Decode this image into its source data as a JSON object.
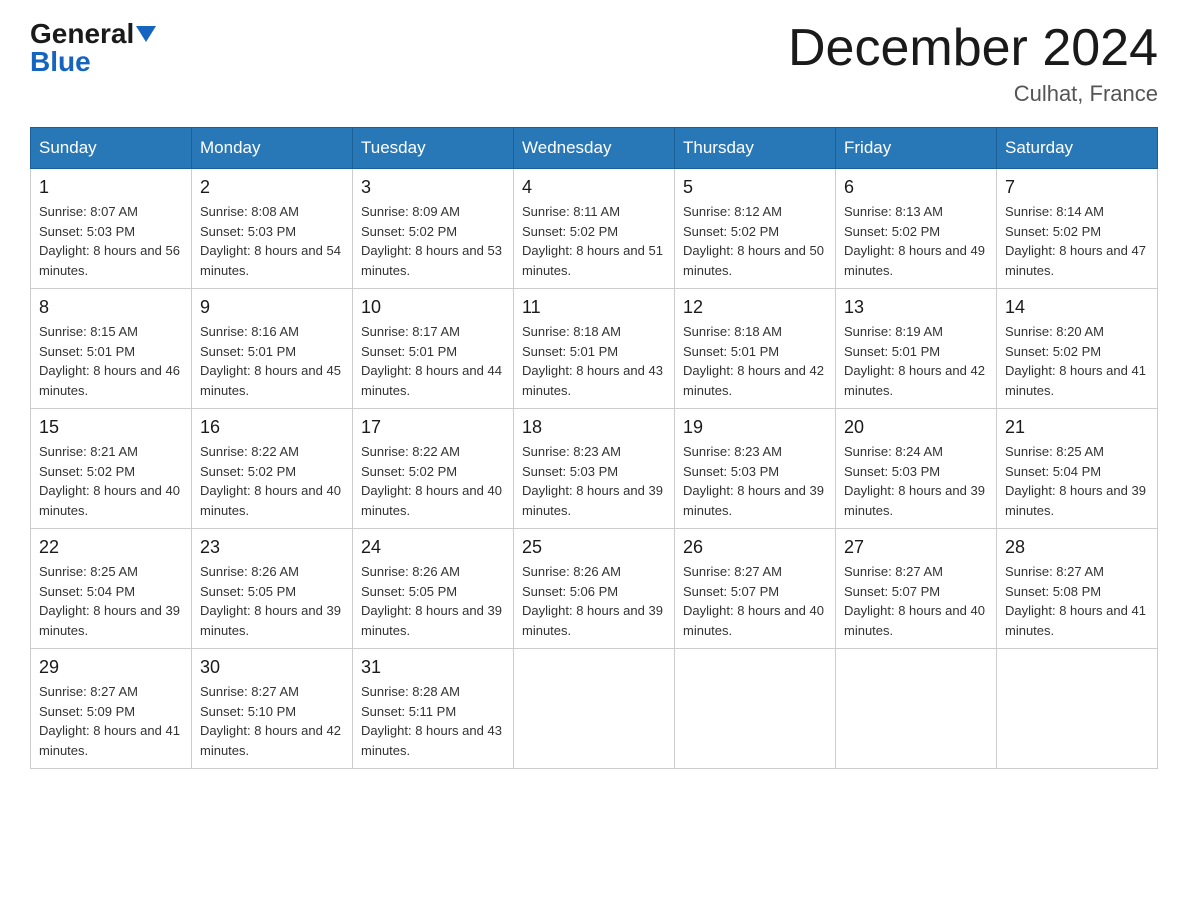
{
  "logo": {
    "general": "General",
    "blue": "Blue"
  },
  "title": {
    "month_year": "December 2024",
    "location": "Culhat, France"
  },
  "weekdays": [
    "Sunday",
    "Monday",
    "Tuesday",
    "Wednesday",
    "Thursday",
    "Friday",
    "Saturday"
  ],
  "weeks": [
    [
      {
        "day": "1",
        "sunrise": "8:07 AM",
        "sunset": "5:03 PM",
        "daylight": "8 hours and 56 minutes."
      },
      {
        "day": "2",
        "sunrise": "8:08 AM",
        "sunset": "5:03 PM",
        "daylight": "8 hours and 54 minutes."
      },
      {
        "day": "3",
        "sunrise": "8:09 AM",
        "sunset": "5:02 PM",
        "daylight": "8 hours and 53 minutes."
      },
      {
        "day": "4",
        "sunrise": "8:11 AM",
        "sunset": "5:02 PM",
        "daylight": "8 hours and 51 minutes."
      },
      {
        "day": "5",
        "sunrise": "8:12 AM",
        "sunset": "5:02 PM",
        "daylight": "8 hours and 50 minutes."
      },
      {
        "day": "6",
        "sunrise": "8:13 AM",
        "sunset": "5:02 PM",
        "daylight": "8 hours and 49 minutes."
      },
      {
        "day": "7",
        "sunrise": "8:14 AM",
        "sunset": "5:02 PM",
        "daylight": "8 hours and 47 minutes."
      }
    ],
    [
      {
        "day": "8",
        "sunrise": "8:15 AM",
        "sunset": "5:01 PM",
        "daylight": "8 hours and 46 minutes."
      },
      {
        "day": "9",
        "sunrise": "8:16 AM",
        "sunset": "5:01 PM",
        "daylight": "8 hours and 45 minutes."
      },
      {
        "day": "10",
        "sunrise": "8:17 AM",
        "sunset": "5:01 PM",
        "daylight": "8 hours and 44 minutes."
      },
      {
        "day": "11",
        "sunrise": "8:18 AM",
        "sunset": "5:01 PM",
        "daylight": "8 hours and 43 minutes."
      },
      {
        "day": "12",
        "sunrise": "8:18 AM",
        "sunset": "5:01 PM",
        "daylight": "8 hours and 42 minutes."
      },
      {
        "day": "13",
        "sunrise": "8:19 AM",
        "sunset": "5:01 PM",
        "daylight": "8 hours and 42 minutes."
      },
      {
        "day": "14",
        "sunrise": "8:20 AM",
        "sunset": "5:02 PM",
        "daylight": "8 hours and 41 minutes."
      }
    ],
    [
      {
        "day": "15",
        "sunrise": "8:21 AM",
        "sunset": "5:02 PM",
        "daylight": "8 hours and 40 minutes."
      },
      {
        "day": "16",
        "sunrise": "8:22 AM",
        "sunset": "5:02 PM",
        "daylight": "8 hours and 40 minutes."
      },
      {
        "day": "17",
        "sunrise": "8:22 AM",
        "sunset": "5:02 PM",
        "daylight": "8 hours and 40 minutes."
      },
      {
        "day": "18",
        "sunrise": "8:23 AM",
        "sunset": "5:03 PM",
        "daylight": "8 hours and 39 minutes."
      },
      {
        "day": "19",
        "sunrise": "8:23 AM",
        "sunset": "5:03 PM",
        "daylight": "8 hours and 39 minutes."
      },
      {
        "day": "20",
        "sunrise": "8:24 AM",
        "sunset": "5:03 PM",
        "daylight": "8 hours and 39 minutes."
      },
      {
        "day": "21",
        "sunrise": "8:25 AM",
        "sunset": "5:04 PM",
        "daylight": "8 hours and 39 minutes."
      }
    ],
    [
      {
        "day": "22",
        "sunrise": "8:25 AM",
        "sunset": "5:04 PM",
        "daylight": "8 hours and 39 minutes."
      },
      {
        "day": "23",
        "sunrise": "8:26 AM",
        "sunset": "5:05 PM",
        "daylight": "8 hours and 39 minutes."
      },
      {
        "day": "24",
        "sunrise": "8:26 AM",
        "sunset": "5:05 PM",
        "daylight": "8 hours and 39 minutes."
      },
      {
        "day": "25",
        "sunrise": "8:26 AM",
        "sunset": "5:06 PM",
        "daylight": "8 hours and 39 minutes."
      },
      {
        "day": "26",
        "sunrise": "8:27 AM",
        "sunset": "5:07 PM",
        "daylight": "8 hours and 40 minutes."
      },
      {
        "day": "27",
        "sunrise": "8:27 AM",
        "sunset": "5:07 PM",
        "daylight": "8 hours and 40 minutes."
      },
      {
        "day": "28",
        "sunrise": "8:27 AM",
        "sunset": "5:08 PM",
        "daylight": "8 hours and 41 minutes."
      }
    ],
    [
      {
        "day": "29",
        "sunrise": "8:27 AM",
        "sunset": "5:09 PM",
        "daylight": "8 hours and 41 minutes."
      },
      {
        "day": "30",
        "sunrise": "8:27 AM",
        "sunset": "5:10 PM",
        "daylight": "8 hours and 42 minutes."
      },
      {
        "day": "31",
        "sunrise": "8:28 AM",
        "sunset": "5:11 PM",
        "daylight": "8 hours and 43 minutes."
      },
      null,
      null,
      null,
      null
    ]
  ],
  "labels": {
    "sunrise": "Sunrise: ",
    "sunset": "Sunset: ",
    "daylight": "Daylight: "
  }
}
